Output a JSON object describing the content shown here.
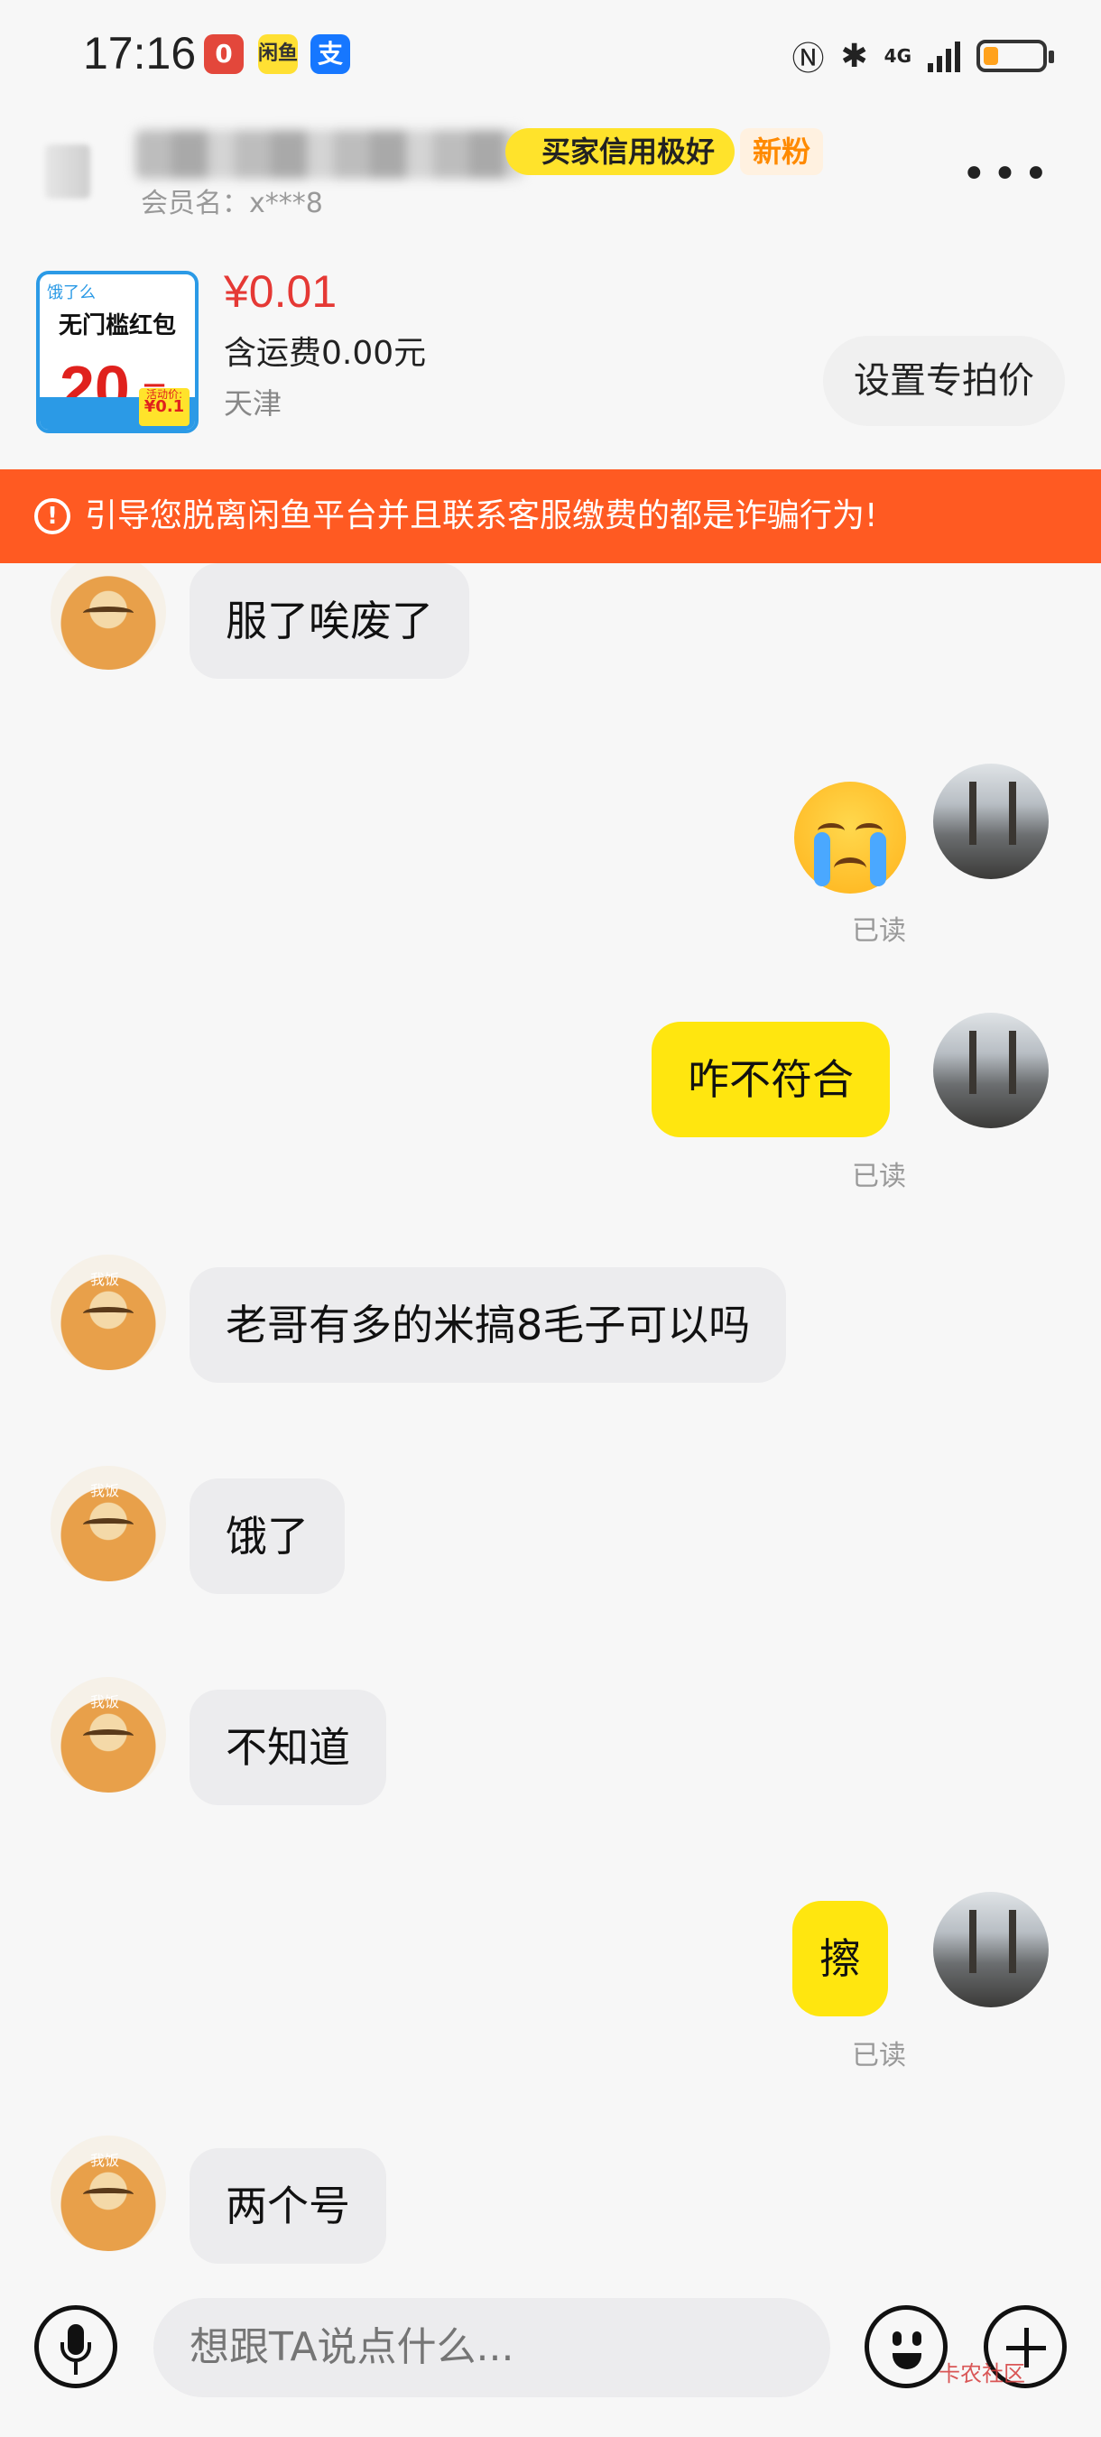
{
  "status_bar": {
    "time": "17:16",
    "network": "4G",
    "battery_level": 0.25,
    "app_badges": [
      "0",
      "闲鱼",
      "支"
    ]
  },
  "header": {
    "member_label": "会员名：x***8",
    "credit_badge": "买家信用极好",
    "fans_badge": "新粉",
    "more_icon": "more-dots-icon"
  },
  "product": {
    "image": {
      "brand": "饿了么",
      "title": "无门槛红包",
      "amount": "20",
      "unit": "元",
      "sale_label": "活动价:",
      "sale_price": "¥0.1"
    },
    "price": "¥0.01",
    "shipping": "含运费0.00元",
    "location": "天津",
    "action_button": "设置专拍价"
  },
  "warning": {
    "text": "引导您脱离闲鱼平台并且联系客服缴费的都是诈骗行为!",
    "icon": "alert-circle-icon"
  },
  "messages": [
    {
      "side": "left",
      "text": "服了唉废了"
    },
    {
      "side": "right",
      "type": "emoji",
      "icon": "crying-face-emoji",
      "status": "已读"
    },
    {
      "side": "right",
      "text": "咋不符合",
      "status": "已读"
    },
    {
      "side": "left",
      "text": "老哥有多的米搞8毛子可以吗"
    },
    {
      "side": "left",
      "text": "饿了"
    },
    {
      "side": "left",
      "text": "不知道"
    },
    {
      "side": "right",
      "text": "擦",
      "status": "已读"
    },
    {
      "side": "left",
      "text": "两个号"
    }
  ],
  "avatar_tag": "我饭",
  "input": {
    "placeholder": "想跟TA说点什么...",
    "voice_icon": "microphone-icon",
    "emoji_icon": "smiley-icon",
    "plus_icon": "plus-circle-icon"
  },
  "watermark": "卡农社区"
}
